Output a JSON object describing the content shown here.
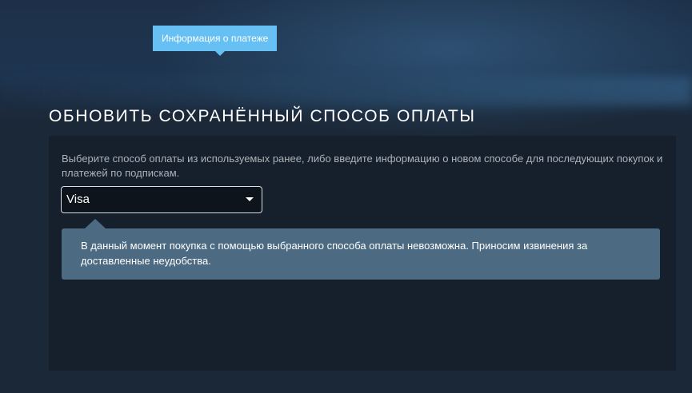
{
  "tooltip": {
    "text": "Информация о платеже"
  },
  "page": {
    "title": "ОБНОВИТЬ СОХРАНЁННЫЙ СПОСОБ ОПЛАТЫ"
  },
  "form": {
    "instructions": "Выберите способ оплаты из используемых ранее, либо введите информацию о новом способе для последующих покупок и платежей по подпискам.",
    "payment_method": {
      "selected": "Visa"
    },
    "notice": "В данный момент покупка с помощью выбранного способа оплаты невозможна. Приносим извинения за доставленные неудобства."
  },
  "colors": {
    "background": "#1b2838",
    "panel": "#16202d",
    "tooltip": "#66c0f4",
    "notice": "#4c6b82",
    "text_muted": "#acb2b8"
  }
}
